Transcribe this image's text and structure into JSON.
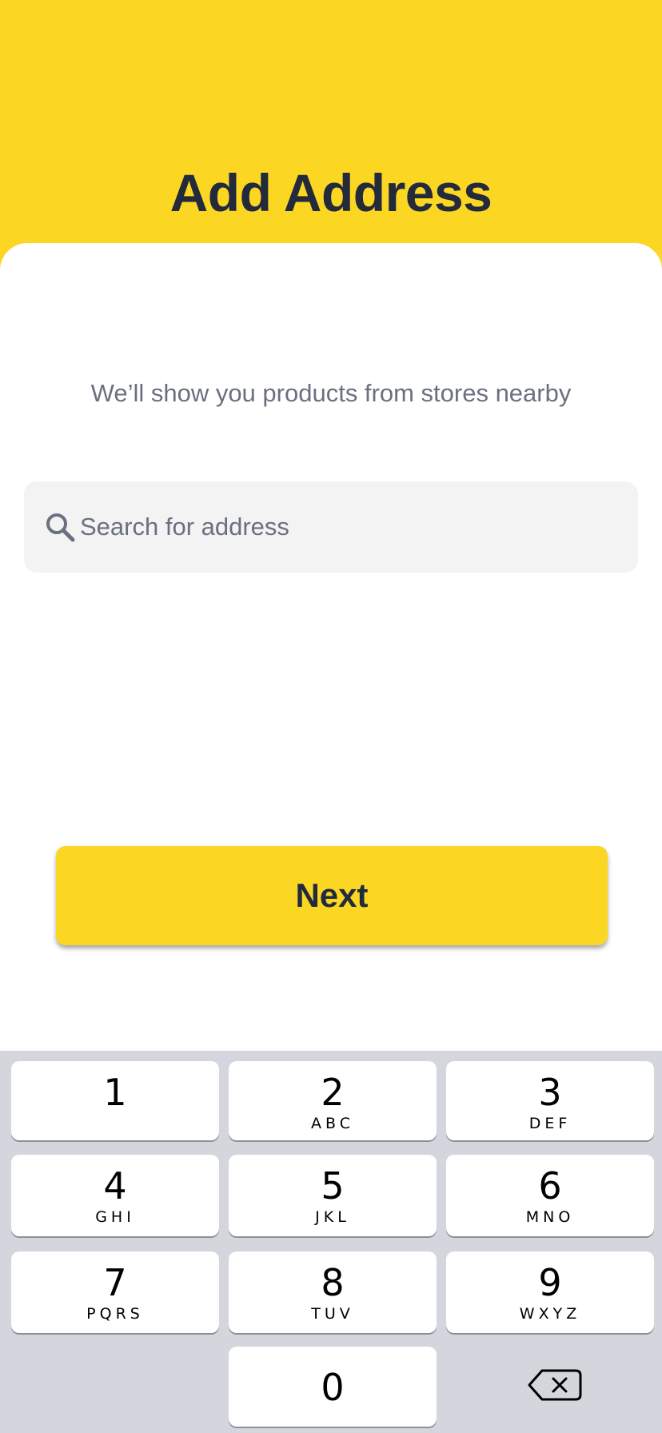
{
  "header": {
    "title": "Add Address"
  },
  "main": {
    "subtitle": "We’ll show you products from stores nearby",
    "search": {
      "placeholder": "Search for address",
      "value": "",
      "icon": "search-icon"
    },
    "next_label": "Next"
  },
  "keyboard": {
    "keys": [
      {
        "num": "1",
        "letters": ""
      },
      {
        "num": "2",
        "letters": "ABC"
      },
      {
        "num": "3",
        "letters": "DEF"
      },
      {
        "num": "4",
        "letters": "GHI"
      },
      {
        "num": "5",
        "letters": "JKL"
      },
      {
        "num": "6",
        "letters": "MNO"
      },
      {
        "num": "7",
        "letters": "PQRS"
      },
      {
        "num": "8",
        "letters": "TUV"
      },
      {
        "num": "9",
        "letters": "WXYZ"
      },
      {
        "num": "0",
        "letters": ""
      }
    ],
    "delete_icon": "backspace-icon"
  },
  "colors": {
    "brand_yellow": "#FBD724",
    "title_text": "#232A3B",
    "muted_text": "#6B7080",
    "search_bg": "#F3F3F4",
    "keyboard_bg": "#D3D6DC"
  }
}
